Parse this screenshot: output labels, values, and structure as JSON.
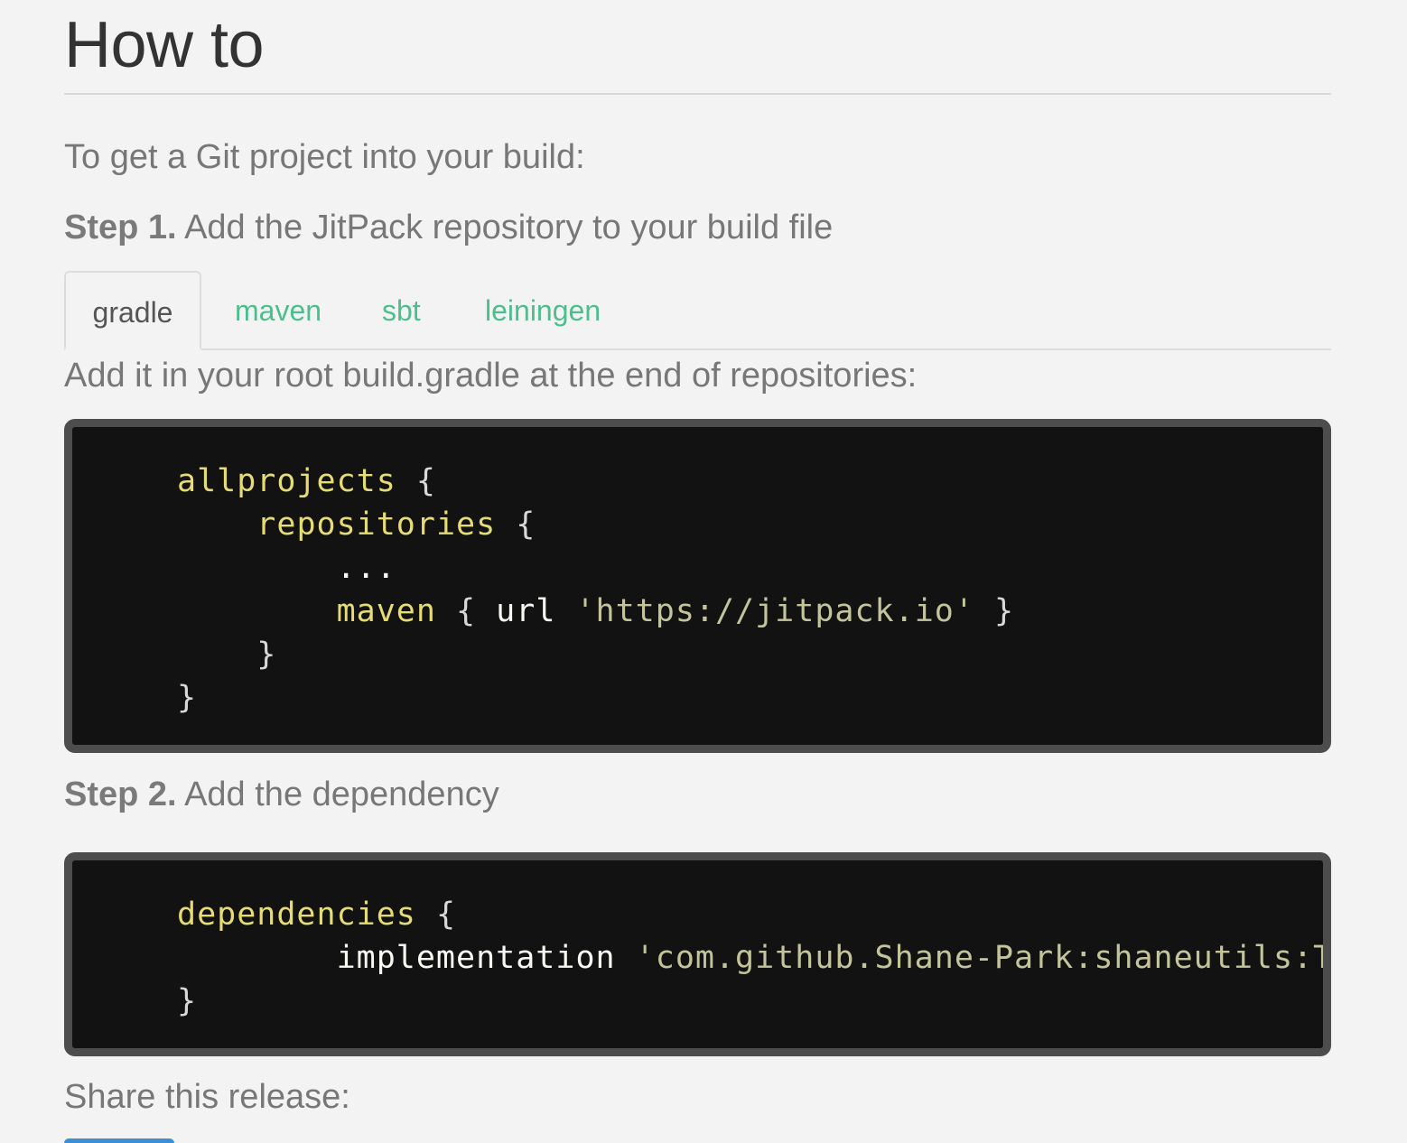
{
  "section": {
    "title": "How to",
    "intro": "To get a Git project into your build:"
  },
  "step1": {
    "label": "Step 1.",
    "text": "Add the JitPack repository to your build file"
  },
  "tabs": [
    {
      "label": "gradle",
      "active": true
    },
    {
      "label": "maven",
      "active": false
    },
    {
      "label": "sbt",
      "active": false
    },
    {
      "label": "leiningen",
      "active": false
    }
  ],
  "instruction": "Add it in your root build.gradle at the end of repositories:",
  "code1": {
    "line1_kw": "allprojects",
    "line1_brace": "{",
    "line2_kw": "repositories",
    "line2_brace": "{",
    "line3": "...",
    "line4_kw": "maven",
    "line4_open": "{",
    "line4_key": "url",
    "line4_str": "'https://jitpack.io'",
    "line4_close": "}",
    "line5": "}",
    "line6": "}"
  },
  "step2": {
    "label": "Step 2.",
    "text": "Add the dependency"
  },
  "code2": {
    "line1_kw": "dependencies",
    "line1_brace": "{",
    "line2_key": "implementation",
    "line2_str": "'com.github.Shane-Park:shaneutils:Tag'",
    "line3": "}"
  },
  "share": {
    "label": "Share this release:"
  },
  "colors": {
    "background": "#f3f3f3",
    "tab_link": "#4cbf8c",
    "code_bg": "#121212",
    "code_border": "#4d4d4d",
    "code_keyword": "#e6db74",
    "code_string": "#c4c49a",
    "share_button": "#3b8ed8"
  }
}
